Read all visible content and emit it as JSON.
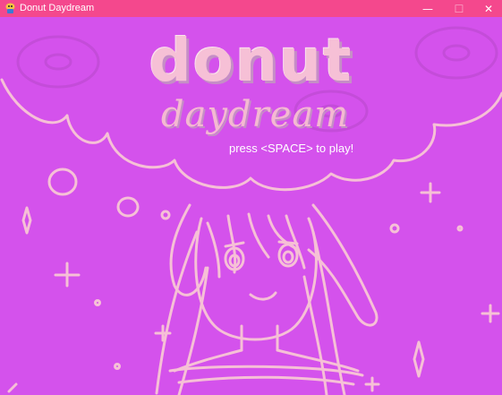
{
  "window": {
    "title": "Donut Daydream",
    "minimize_glyph": "—",
    "maximize_glyph": "☐",
    "close_glyph": "✕"
  },
  "game": {
    "title_line1": "donut",
    "title_line2": "daydream",
    "prompt": "press <SPACE> to play!"
  },
  "colors": {
    "titlebar": "#f4488d",
    "background": "#d452ec",
    "lineart": "#f6c0d6"
  }
}
